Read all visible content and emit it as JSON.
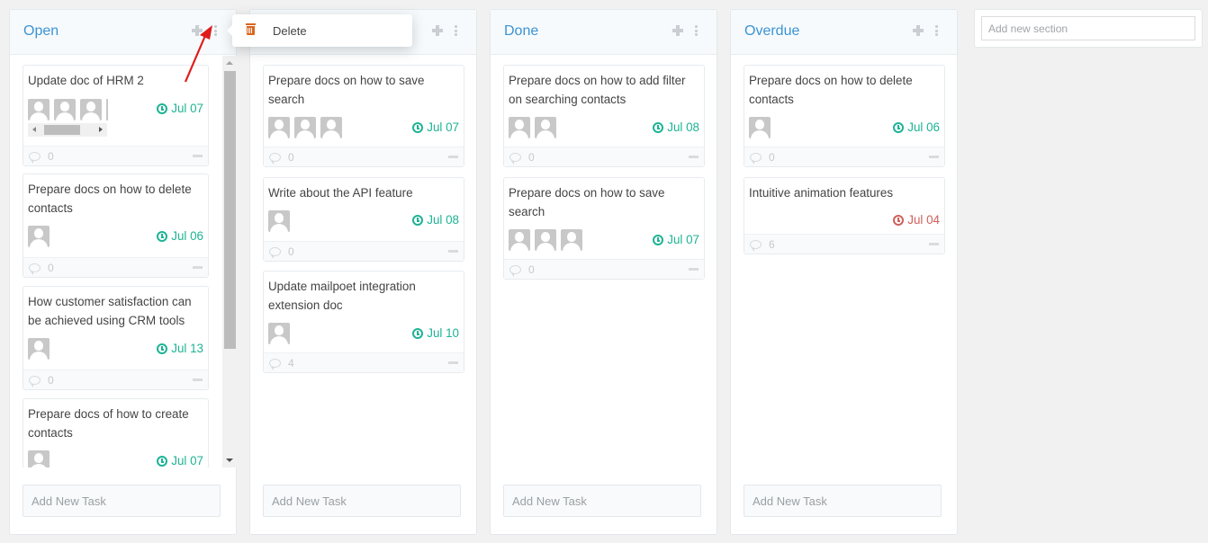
{
  "columns": [
    {
      "title": "Open",
      "add_task_placeholder": "Add New Task",
      "cards": [
        {
          "title": "Update doc of HRM 2",
          "assignees": 4,
          "due": "Jul 07",
          "due_status": "upcoming",
          "comments": "0"
        },
        {
          "title": "Prepare docs on how to delete contacts",
          "assignees": 1,
          "due": "Jul 06",
          "due_status": "upcoming",
          "comments": "0"
        },
        {
          "title": "How customer satisfaction can be achieved using CRM tools",
          "assignees": 1,
          "due": "Jul 13",
          "due_status": "upcoming",
          "comments": "0"
        },
        {
          "title": "Prepare docs of how to create contacts",
          "assignees": 1,
          "due": "Jul 07",
          "due_status": "upcoming",
          "comments": ""
        }
      ]
    },
    {
      "title": "",
      "add_task_placeholder": "Add New Task",
      "cards": [
        {
          "title": "Prepare docs on how to save search",
          "assignees": 3,
          "due": "Jul 07",
          "due_status": "upcoming",
          "comments": "0"
        },
        {
          "title": "Write about the API feature",
          "assignees": 1,
          "due": "Jul 08",
          "due_status": "upcoming",
          "comments": "0"
        },
        {
          "title": "Update mailpoet integration extension doc",
          "assignees": 1,
          "due": "Jul 10",
          "due_status": "upcoming",
          "comments": "4"
        }
      ]
    },
    {
      "title": "Done",
      "add_task_placeholder": "Add New Task",
      "cards": [
        {
          "title": "Prepare docs on how to add filter on searching contacts",
          "assignees": 2,
          "due": "Jul 08",
          "due_status": "upcoming",
          "comments": "0"
        },
        {
          "title": "Prepare docs on how to save search",
          "assignees": 3,
          "due": "Jul 07",
          "due_status": "upcoming",
          "comments": "0"
        }
      ]
    },
    {
      "title": "Overdue",
      "add_task_placeholder": "Add New Task",
      "cards": [
        {
          "title": "Prepare docs on how to delete contacts",
          "assignees": 1,
          "due": "Jul 06",
          "due_status": "upcoming",
          "comments": "0"
        },
        {
          "title": "Intuitive animation features",
          "assignees": 0,
          "due": "Jul 04",
          "due_status": "overdue",
          "comments": "6"
        }
      ]
    }
  ],
  "section_menu": {
    "items": [
      {
        "label": "Delete",
        "icon": "trash-icon"
      }
    ]
  },
  "new_section": {
    "placeholder": "Add new section"
  },
  "colors": {
    "title": "#3a94d3",
    "due_upcoming": "#1db394",
    "due_overdue": "#d0605c",
    "delete_icon": "#d9661f"
  }
}
